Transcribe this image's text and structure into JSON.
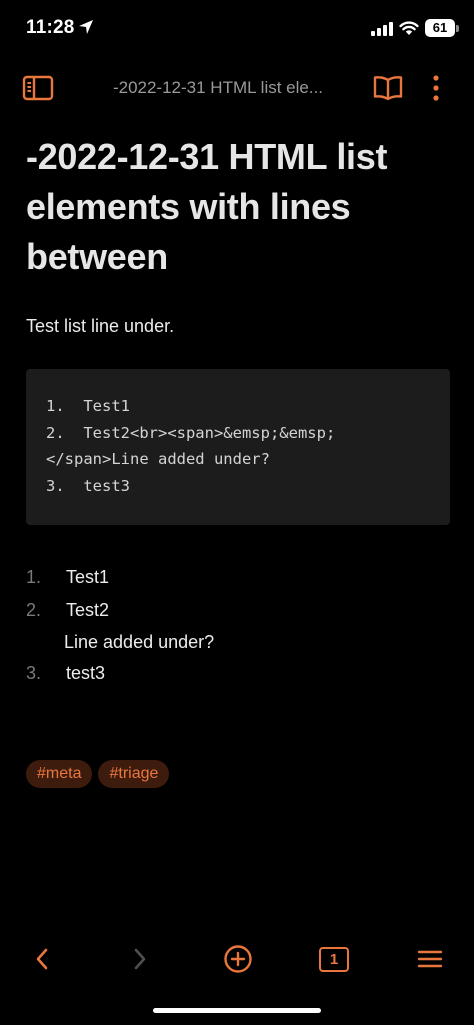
{
  "status": {
    "time": "11:28",
    "battery": "61"
  },
  "nav": {
    "title": "-2022-12-31 HTML list ele..."
  },
  "note": {
    "title": "-2022-12-31 HTML list elements with lines between",
    "paragraph": "Test list line under.",
    "code_lines": [
      "1.  Test1",
      "2.  Test2<br><span>&emsp;&emsp;",
      "</span>Line added under?",
      "3.  test3"
    ],
    "list": [
      {
        "num": "1.",
        "text": "Test1"
      },
      {
        "num": "2.",
        "text": "Test2",
        "sub": "Line added under?"
      },
      {
        "num": "3.",
        "text": "test3"
      }
    ],
    "tags": [
      "#meta",
      "#triage"
    ]
  },
  "toolbar": {
    "tab_count": "1"
  },
  "colors": {
    "accent": "#e9763c",
    "background": "#000000",
    "code_bg": "#1c1c1c",
    "tag_bg": "#3d1c0e"
  }
}
